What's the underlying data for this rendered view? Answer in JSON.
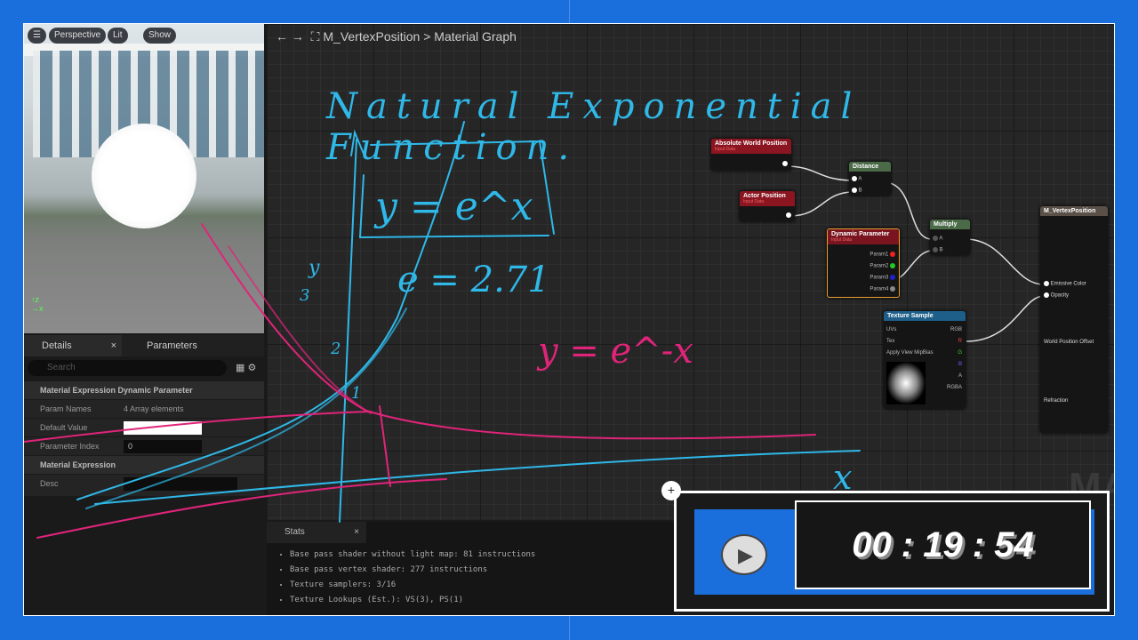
{
  "viewport": {
    "buttons": [
      "Perspective",
      "Lit",
      "Show"
    ]
  },
  "details": {
    "tabs": [
      "Details",
      "Parameters"
    ],
    "search_placeholder": "Search",
    "sections": [
      "Material Expression Dynamic Parameter",
      "Material Expression"
    ],
    "rows": [
      {
        "label": "Param Names",
        "value": "4 Array elements"
      },
      {
        "label": "Default Value",
        "value": ""
      },
      {
        "label": "Parameter Index",
        "value": "0"
      },
      {
        "label": "Desc",
        "value": ""
      }
    ]
  },
  "graph": {
    "breadcrumb": {
      "asset": "M_VertexPosition",
      "separator": ">",
      "page": "Material Graph"
    },
    "nodes": {
      "abs_world": {
        "title": "Absolute World Position",
        "sub": "Input Data"
      },
      "actor_pos": {
        "title": "Actor Position",
        "sub": "Input Data"
      },
      "distance": {
        "title": "Distance",
        "pins": [
          "A",
          "B"
        ]
      },
      "multiply": {
        "title": "Multiply",
        "pins": [
          "A",
          "B"
        ]
      },
      "dynamic": {
        "title": "Dynamic Parameter",
        "sub": "Input Data",
        "pins": [
          "Param1",
          "Param2",
          "Param3",
          "Param4"
        ]
      },
      "texture": {
        "title": "Texture Sample",
        "inputs": [
          "UVs",
          "Tex",
          "Apply View MipBias"
        ],
        "outputs": [
          "RGB",
          "R",
          "G",
          "B",
          "A",
          "RGBA"
        ]
      },
      "result": {
        "title": "M_VertexPosition",
        "pins": [
          "Emissive Color",
          "Opacity",
          "World Position Offset",
          "Refraction"
        ]
      }
    },
    "watermark": "MAT"
  },
  "annotations": {
    "title": "Natural Exponential Function.",
    "eq1": "y = e^x",
    "eq2": "e = 2.71",
    "eq3": "y = e^-x",
    "axis_y": "y",
    "axis_x": "x",
    "ticks": [
      "3",
      "2",
      "1"
    ],
    "colors": {
      "cyan": "#2fb8e8",
      "magenta": "#e0247a"
    }
  },
  "stats": {
    "tab": "Stats",
    "lines": [
      "Base pass shader without light map: 81 instructions",
      "Base pass vertex shader: 277 instructions",
      "Texture samplers: 3/16",
      "Texture Lookups (Est.): VS(3), PS(1)"
    ]
  },
  "timer": {
    "time": "00 : 19 : 54"
  },
  "colors": {
    "frame": "#1b6fdc"
  }
}
